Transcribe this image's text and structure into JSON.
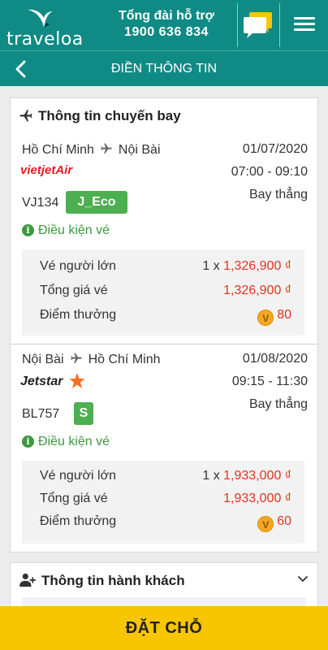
{
  "header": {
    "logo_text": "traveloa",
    "hotline_label": "Tổng đài hỗ trợ",
    "hotline_number": "1900 636 834",
    "chat_icon": "chat-bubbles-icon",
    "menu_icon": "hamburger-menu-icon"
  },
  "subheader": {
    "title": "ĐIỀN THÔNG TIN",
    "back_icon": "chevron-left-icon"
  },
  "flight_info": {
    "title": "Thông tin chuyến bay",
    "title_icon": "airplane-icon",
    "segments": [
      {
        "origin": "Hồ Chí Minh",
        "destination": "Nội Bài",
        "date": "01/07/2020",
        "time": "07:00 - 09:10",
        "stops": "Bay thẳng",
        "airline_logo_text": "vietjetAir",
        "flight_no": "VJ134",
        "fare_class": "J_Eco",
        "conditions_label": "Điều kiện vé",
        "adult_fare_label": "Vé người lớn",
        "adult_fare_qty": "1 x",
        "adult_fare_value": "1,326,900 ₫",
        "total_label": "Tổng giá vé",
        "total_value": "1,326,900 ₫",
        "points_label": "Điểm thưởng",
        "points_coin": "V",
        "points_value": "80"
      },
      {
        "origin": "Nội Bài",
        "destination": "Hồ Chí Minh",
        "date": "01/08/2020",
        "time": "09:15 - 11:30",
        "stops": "Bay thẳng",
        "airline_logo_text": "Jetstar",
        "flight_no": "BL757",
        "fare_class": "S",
        "conditions_label": "Điều kiện vé",
        "adult_fare_label": "Vé người lớn",
        "adult_fare_qty": "1 x",
        "adult_fare_value": "1,933,000 ₫",
        "total_label": "Tổng giá vé",
        "total_value": "1,933,000 ₫",
        "points_label": "Điểm thưởng",
        "points_coin": "V",
        "points_value": "60"
      }
    ]
  },
  "passenger_info": {
    "title": "Thông tin hành khách",
    "title_icon": "add-user-icon",
    "toggle_icon": "chevron-down-icon"
  },
  "cta": {
    "book_label": "ĐẶT CHỖ"
  },
  "colors": {
    "brand_teal": "#0f8a84",
    "cta_yellow": "#f7c600",
    "price_red": "#e0321e",
    "badge_green": "#4caf50",
    "vietjet_red": "#e31b23",
    "jetstar_orange": "#f37021"
  }
}
